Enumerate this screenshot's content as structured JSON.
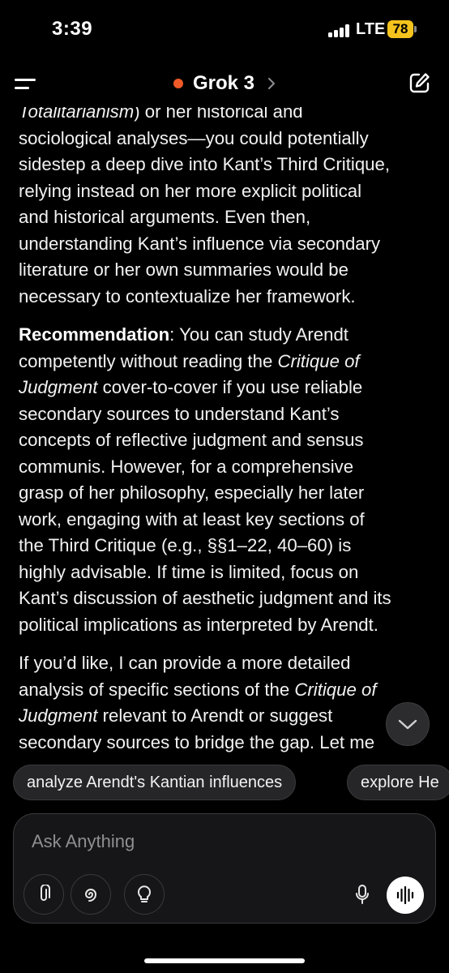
{
  "status_bar": {
    "time": "3:39",
    "network": "LTE",
    "battery": "78",
    "battery_color": "#f5c31d"
  },
  "nav": {
    "title": "Grok 3",
    "status_dot_color": "#f05a28",
    "icons": {
      "menu": "hamburger-icon",
      "chevron": "chevron-right-icon",
      "new_chat": "edit-icon"
    }
  },
  "message": {
    "p1": {
      "line0_italic": "Totalitarianism",
      "line0_rest": ") or her historical and",
      "lines": [
        "sociological analyses—you could potentially",
        "sidestep a deep dive into Kant’s Third Critique,",
        "relying instead on her more explicit political",
        "and historical arguments. Even then,",
        "understanding Kant’s influence via secondary",
        "literature or her own summaries would be",
        "necessary to contextualize her framework."
      ]
    },
    "p2": {
      "label": "Recommendation",
      "l1_rest": ": You can study Arendt",
      "l2_a": "competently without reading the ",
      "l2_i": "Critique of",
      "l3_i": "Judgment",
      "l3_b": " cover-to-cover if you use reliable",
      "lines": [
        "secondary sources to understand Kant’s",
        "concepts of reflective judgment and sensus",
        "communis. However, for a comprehensive",
        "grasp of her philosophy, especially her later",
        "work, engaging with at least key sections of",
        "the Third Critique (e.g., §§1–22, 40–60) is",
        "highly advisable. If time is limited, focus on",
        "Kant’s discussion of aesthetic judgment and its",
        "political implications as interpreted by Arendt."
      ]
    },
    "p3": {
      "l1": "If you’d like, I can provide a more detailed",
      "l2_a": "analysis of specific sections of the ",
      "l2_i": "Critique of",
      "l3_i": "Judgment",
      "l3_b": " relevant to Arendt or suggest",
      "l4": "secondary sources to bridge the gap. Let me"
    }
  },
  "suggestions": [
    "analyze Arendt's Kantian influences",
    "explore He"
  ],
  "composer": {
    "placeholder": "Ask Anything",
    "tools": [
      "paperclip-icon",
      "spiral-icon",
      "lightbulb-icon"
    ],
    "mic_icon": "microphone-icon",
    "voice_icon": "voice-wave-icon"
  }
}
